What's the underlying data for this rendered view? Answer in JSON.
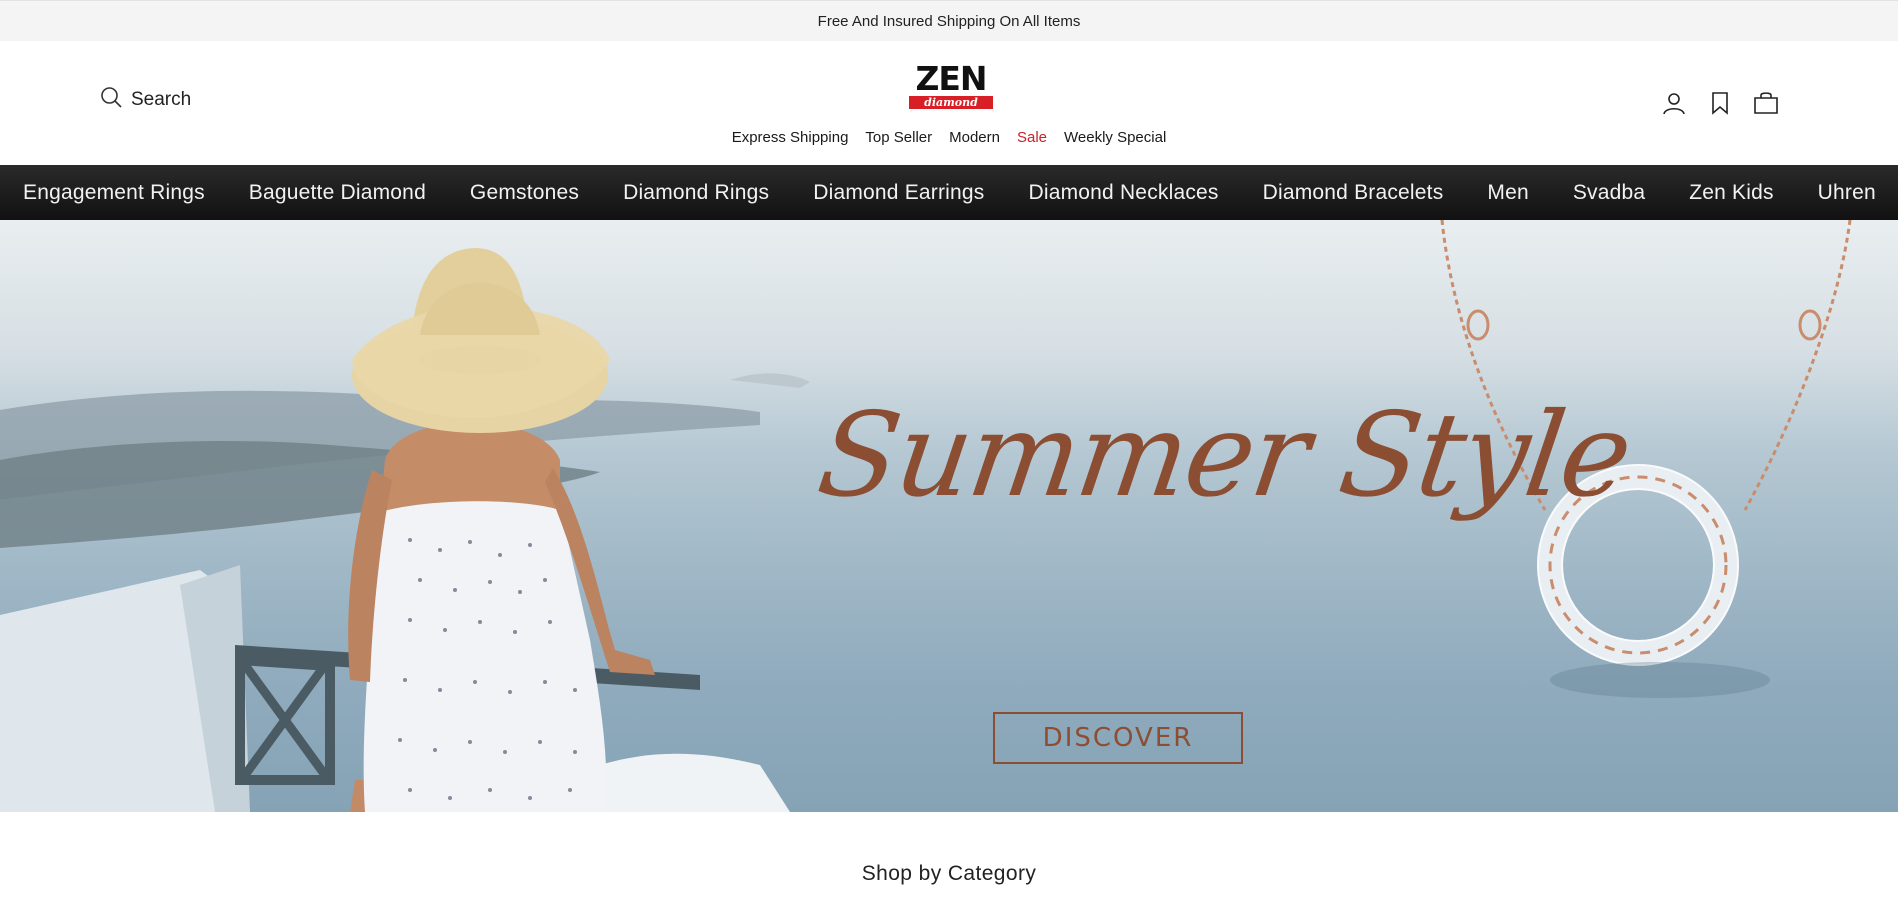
{
  "announcement": {
    "text": "Free And Insured Shipping On All Items"
  },
  "header": {
    "search_label": "Search",
    "logo": {
      "wordmark": "ZEN",
      "sub": "diamond",
      "accent": "#d81f26"
    },
    "subnav": [
      {
        "label": "Express Shipping"
      },
      {
        "label": "Top Seller"
      },
      {
        "label": "Modern"
      },
      {
        "label": "Sale",
        "color": "#c8212a"
      },
      {
        "label": "Weekly Special"
      }
    ],
    "icons": [
      "account-icon",
      "wishlist-icon",
      "cart-icon"
    ]
  },
  "categories": [
    {
      "label": "Engagement Rings"
    },
    {
      "label": "Baguette Diamond"
    },
    {
      "label": "Gemstones"
    },
    {
      "label": "Diamond Rings"
    },
    {
      "label": "Diamond Earrings"
    },
    {
      "label": "Diamond Necklaces"
    },
    {
      "label": "Diamond Bracelets"
    },
    {
      "label": "Men"
    },
    {
      "label": "Svadba"
    },
    {
      "label": "Zen Kids"
    },
    {
      "label": "Uhren"
    }
  ],
  "hero": {
    "headline": "Summer Style",
    "cta": "DISCOVER",
    "accent": "#8b4e33"
  },
  "sections": {
    "shop_by_category": "Shop by Category"
  }
}
